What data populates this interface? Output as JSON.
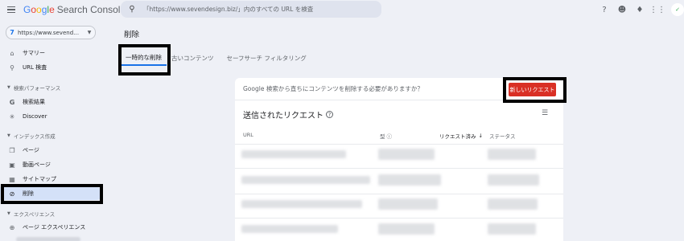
{
  "app": {
    "brand": [
      "G",
      "o",
      "o",
      "g",
      "l",
      "e"
    ],
    "product": "Search Console"
  },
  "search": {
    "placeholder": "「https://www.sevendesign.biz/」内のすべての URL を検査"
  },
  "header_icons": [
    "help-icon",
    "people-icon",
    "bell-icon",
    "apps-grid-icon"
  ],
  "property": {
    "label": "https://www.sevend…",
    "icon": "7"
  },
  "sidebar": {
    "items": [
      {
        "label": "サマリー",
        "icon": "home-icon"
      },
      {
        "label": "URL 検査",
        "icon": "search-icon"
      },
      {
        "label": "検索結果",
        "icon": "google-g-icon"
      },
      {
        "label": "Discover",
        "icon": "asterisk-icon"
      },
      {
        "label": "ページ",
        "icon": "pages-icon"
      },
      {
        "label": "動画ページ",
        "icon": "video-pages-icon"
      },
      {
        "label": "サイトマップ",
        "icon": "sitemap-icon"
      },
      {
        "label": "削除",
        "icon": "eye-off-icon"
      },
      {
        "label": "ページ エクスペリエンス",
        "icon": "add-circle-icon"
      }
    ],
    "sections": {
      "performance": "検索パフォーマンス",
      "index": "インデックス作成",
      "experience": "エクスペリエンス"
    }
  },
  "main": {
    "title": "削除",
    "tabs": [
      "一時的な削除",
      "古いコンテンツ",
      "セーフサーチ フィルタリング"
    ],
    "card": {
      "question": "Google 検索から直ちにコンテンツを削除する必要がありますか？",
      "new_request": "新しいリクエスト",
      "requests_title": "送信されたリクエスト",
      "columns": {
        "url": "URL",
        "type_icon": "型",
        "requested": "リクエスト済み",
        "status": "ステータス"
      }
    }
  },
  "colors": {
    "accent": "#1a73e8",
    "danger": "#d93025",
    "active_nav": "#d4e1f8",
    "background": "#eef0f6"
  }
}
